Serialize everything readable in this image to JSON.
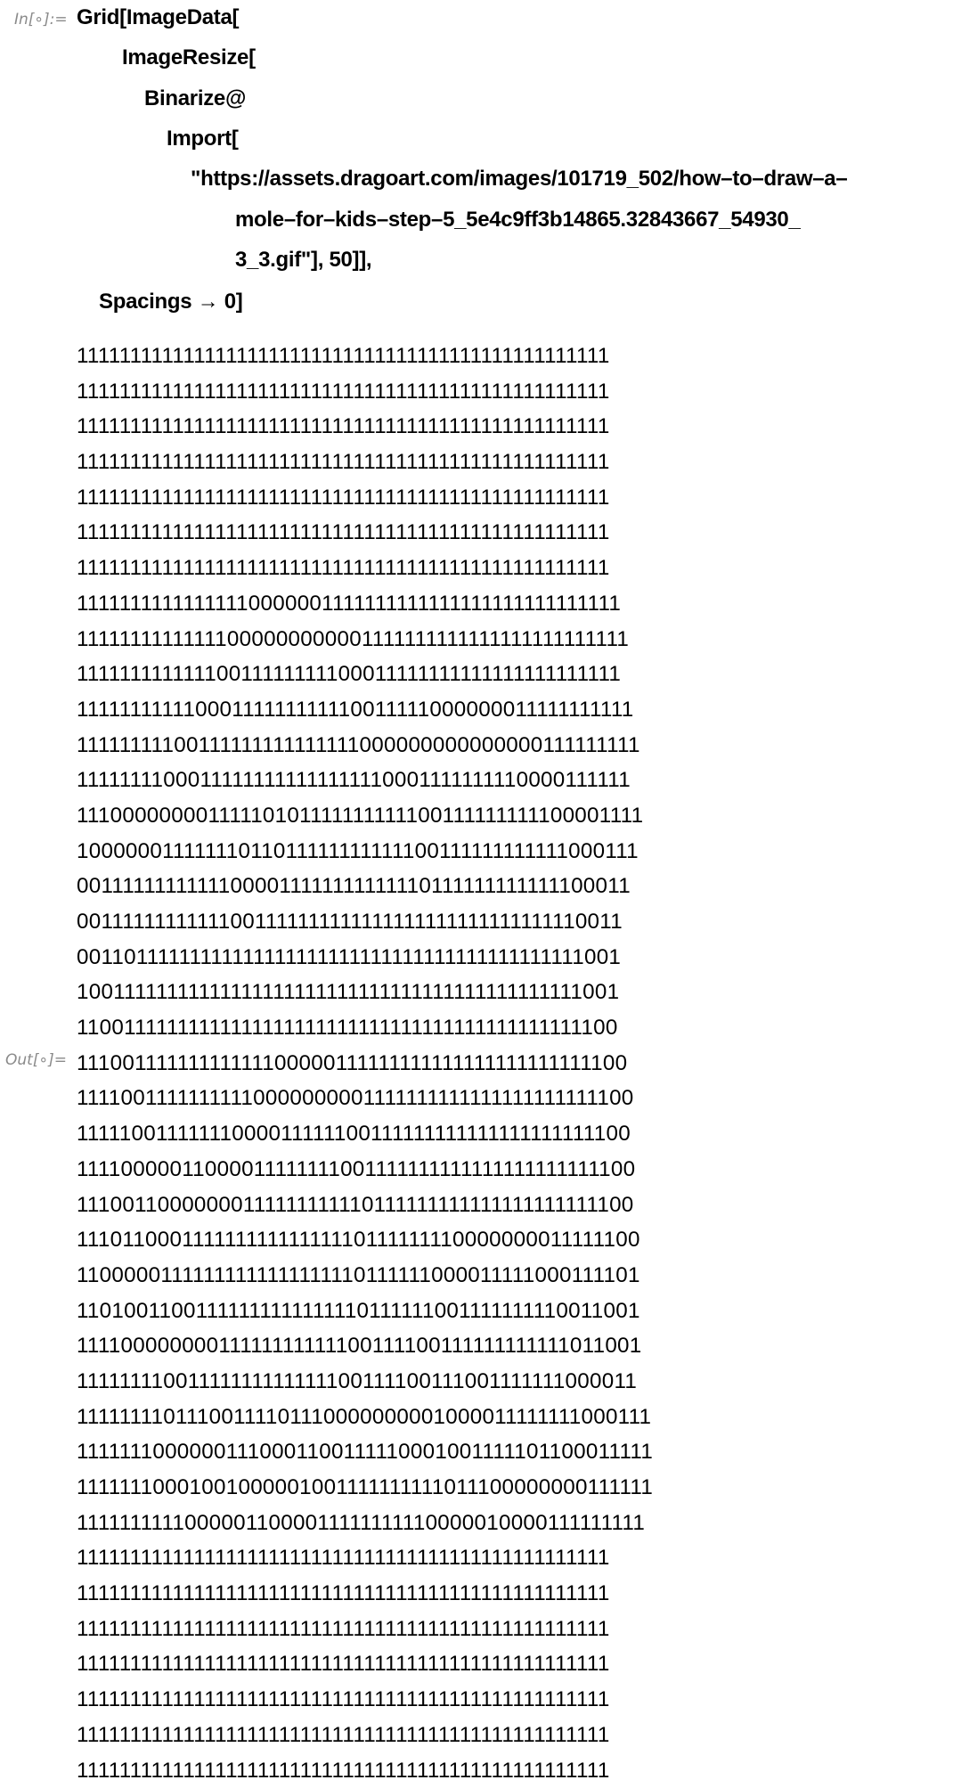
{
  "input": {
    "label": "In[∘]:=",
    "code_lines": [
      "Grid[ImageData[",
      "ImageResize[",
      "Binarize@",
      "Import[",
      "\"https://assets.dragoart.com/images/101719_502/how–to–draw–a–",
      "mole–for–kids–step–5_5e4c9ff3b14865.32843667_54930_",
      "3_3.gif\"], 50]],",
      "Spacings → 0]"
    ]
  },
  "output": {
    "label": "Out[∘]=",
    "rows": [
      "11111111111111111111111111111111111111111111111111",
      "11111111111111111111111111111111111111111111111111",
      "11111111111111111111111111111111111111111111111111",
      "11111111111111111111111111111111111111111111111111",
      "11111111111111111111111111111111111111111111111111",
      "11111111111111111111111111111111111111111111111111",
      "11111111111111111111111111111111111111111111111111",
      "11111111111111110000001111111111111111111111111111",
      "11111111111111000000000001111111111111111111111111",
      "11111111111110011111111100011111111111111111111111",
      "11111111111000111111111110011111000000011111111111",
      "11111111100111111111111111000000000000000111111111",
      "11111111000111111111111111110001111111110000111111",
      "11100000000111110101111111111100111111111100001111",
      "10000001111111011011111111111100111111111111000111",
      "00111111111111000011111111111110111111111111100011",
      "00111111111111001111111111111111111111111111110011",
      "00110111111111111111111111111111111111111111111001",
      "10011111111111111111111111111111111111111111111001",
      "11001111111111111111111111111111111111111111111100",
      "11100111111111111100000111111111111111111111111100",
      "11110011111111110000000001111111111111111111111100",
      "11111001111111000011111100111111111111111111111100",
      "11110000011000011111111001111111111111111111111100",
      "11100110000000111111111110111111111111111111111100",
      "11101100011111111111111110111111110000000011111100",
      "11000001111111111111111110111111000011111000111101",
      "11010011001111111111111110111111001111111110011001",
      "11110000000011111111111100111100111111111111011001",
      "11111111001111111111111100111100111001111111000011",
      "11111111011100111101110000000001000011111111000111",
      "11111110000001110001100111110001001111101100011111",
      "11111110001001000001001111111111011100000000111111",
      "11111111110000011000011111111110000010000111111111",
      "11111111111111111111111111111111111111111111111111",
      "11111111111111111111111111111111111111111111111111",
      "11111111111111111111111111111111111111111111111111",
      "11111111111111111111111111111111111111111111111111",
      "11111111111111111111111111111111111111111111111111",
      "11111111111111111111111111111111111111111111111111",
      "11111111111111111111111111111111111111111111111111"
    ]
  }
}
